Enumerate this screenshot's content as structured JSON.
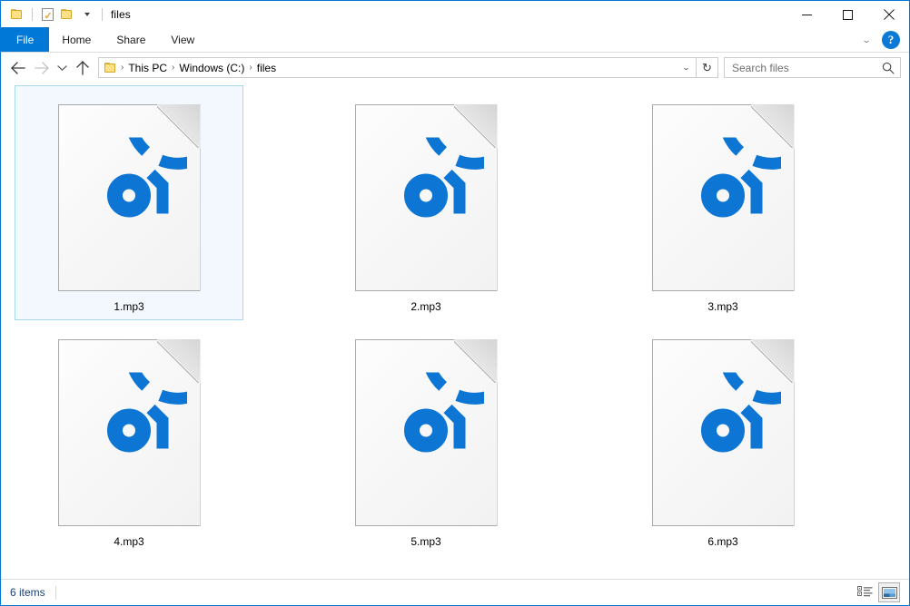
{
  "window": {
    "title": "files",
    "accent_color": "#0078d7",
    "icon_blue": "#0d76d4"
  },
  "quick_access_toolbar": {
    "items": [
      {
        "name": "folder-icon",
        "label": ""
      },
      {
        "name": "properties-icon",
        "label": ""
      },
      {
        "name": "new-folder-icon",
        "label": ""
      },
      {
        "name": "customize-chevron-icon",
        "label": "▾"
      }
    ]
  },
  "window_controls": {
    "minimize": "minimize-icon",
    "maximize": "maximize-icon",
    "close": "close-icon"
  },
  "ribbon": {
    "tabs": [
      {
        "label": "File",
        "active": true
      },
      {
        "label": "Home",
        "active": false
      },
      {
        "label": "Share",
        "active": false
      },
      {
        "label": "View",
        "active": false
      }
    ],
    "expand_chevron": "⌄",
    "help_label": "?"
  },
  "address_bar": {
    "back": "back-arrow-icon",
    "forward": "forward-arrow-icon",
    "recent": "recent-locations-chevron-icon",
    "up": "up-arrow-icon",
    "breadcrumb_separator": "›",
    "breadcrumbs": [
      {
        "label": "This PC"
      },
      {
        "label": "Windows (C:)"
      },
      {
        "label": "files"
      }
    ],
    "dropdown_chevron": "⌄",
    "refresh": "↻"
  },
  "search": {
    "placeholder": "Search files",
    "value": "",
    "icon": "search-icon"
  },
  "files": [
    {
      "name": "1.mp3",
      "icon": "groove-music-file-icon",
      "selected": true
    },
    {
      "name": "2.mp3",
      "icon": "groove-music-file-icon",
      "selected": false
    },
    {
      "name": "3.mp3",
      "icon": "groove-music-file-icon",
      "selected": false
    },
    {
      "name": "4.mp3",
      "icon": "groove-music-file-icon",
      "selected": false
    },
    {
      "name": "5.mp3",
      "icon": "groove-music-file-icon",
      "selected": false
    },
    {
      "name": "6.mp3",
      "icon": "groove-music-file-icon",
      "selected": false
    }
  ],
  "status_bar": {
    "item_count_text": "6 items",
    "views": [
      {
        "name": "details-view-button",
        "active": false
      },
      {
        "name": "large-icons-view-button",
        "active": true
      }
    ]
  }
}
